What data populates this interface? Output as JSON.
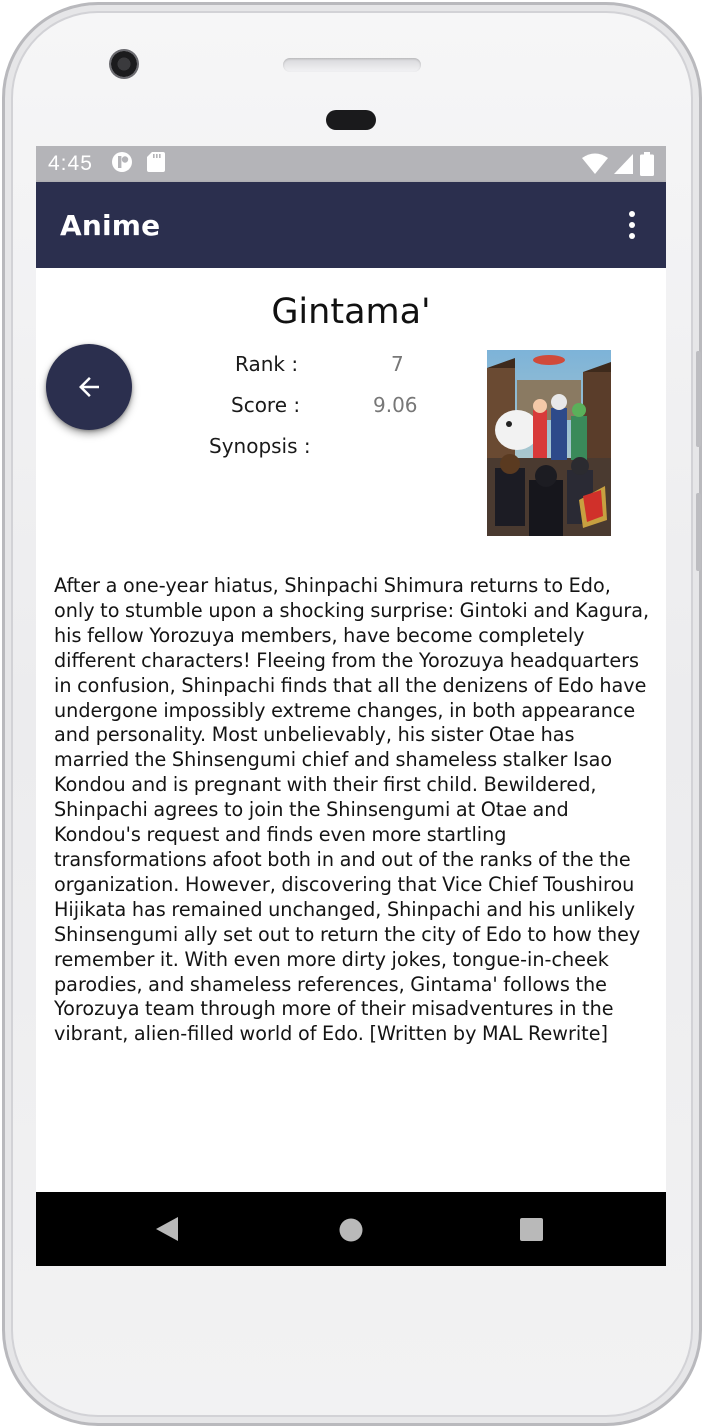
{
  "status_bar": {
    "time": "4:45",
    "left_icons": [
      "notification-app-icon",
      "sd-card-icon"
    ],
    "right_icons": [
      "wifi-icon",
      "cellular-signal-icon",
      "battery-icon"
    ]
  },
  "app_bar": {
    "title": "Anime",
    "menu_icon": "more-vert-icon",
    "background_color": "#2b2f4e"
  },
  "detail": {
    "title": "Gintama'",
    "rank_label": "Rank :",
    "rank_value": "7",
    "score_label": "Score :",
    "score_value": "9.06",
    "synopsis_label": "Synopsis :",
    "poster_icon": "anime-poster-image",
    "synopsis": "After a one-year hiatus, Shinpachi Shimura returns to Edo, only to stumble upon a shocking surprise: Gintoki and Kagura, his fellow Yorozuya members, have become completely different characters! Fleeing from the Yorozuya headquarters in confusion, Shinpachi finds that all the denizens of Edo have undergone impossibly extreme changes, in both appearance and personality. Most unbelievably, his sister Otae has married the Shinsengumi chief and shameless stalker Isao Kondou and is pregnant with their first child. Bewildered, Shinpachi agrees to join the Shinsengumi at Otae and Kondou's request and finds even more startling transformations afoot both in and out of the ranks of the the organization. However, discovering that Vice Chief Toushirou Hijikata has remained unchanged, Shinpachi and his unlikely Shinsengumi ally set out to return the city of Edo to how they remember it. With even more dirty jokes, tongue-in-cheek parodies, and shameless references, Gintama' follows the Yorozuya team through more of their misadventures in the vibrant, alien-filled world of Edo. [Written by MAL Rewrite]"
  },
  "fab": {
    "icon": "arrow-back-icon"
  },
  "nav_bar": {
    "buttons": [
      "back-triangle-icon",
      "home-circle-icon",
      "recents-square-icon"
    ]
  }
}
